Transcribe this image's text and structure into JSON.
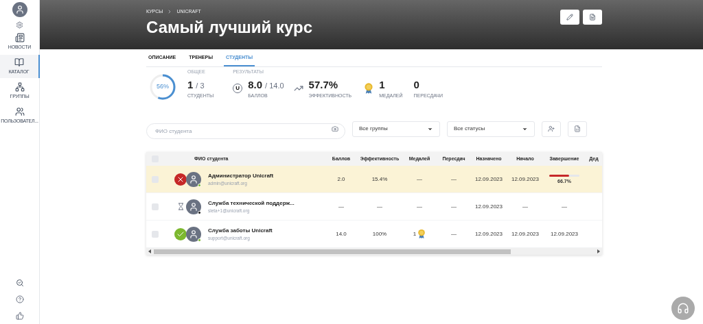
{
  "sidebar": {
    "items": [
      {
        "label": "НОВОСТИ",
        "selected": false
      },
      {
        "label": "КАТАЛОГ",
        "selected": true
      },
      {
        "label": "ГРУППЫ",
        "selected": false
      },
      {
        "label": "ПОЛЬЗОВАТЕЛ...",
        "selected": false
      }
    ]
  },
  "breadcrumbs": [
    "КУРСЫ",
    "UNICRAFT"
  ],
  "title": "Самый лучший курс",
  "tabs": [
    {
      "label": "ОПИСАНИЕ",
      "selected": false
    },
    {
      "label": "ТРЕНЕРЫ",
      "selected": false
    },
    {
      "label": "СТУДЕНТЫ",
      "selected": true
    }
  ],
  "progress": {
    "reading": "56%",
    "level": 0.56
  },
  "stats": {
    "general_label": "ОБЩЕЕ",
    "results_label": "РЕЗУЛЬТАТЫ",
    "students": {
      "value": "1",
      "total": "/ 3",
      "label": "СТУДЕНТЫ"
    },
    "points_icon": "U",
    "points": {
      "value": "8.0",
      "total": "/ 14.0",
      "label": "БАЛЛОВ"
    },
    "efficiency": {
      "value": "57.7%",
      "label": "ЭФФЕКТИВНОСТЬ"
    },
    "medals": {
      "value": "1",
      "label": "МЕДАЛЕЙ"
    },
    "retakes": {
      "value": "0",
      "label": "ПЕРЕСДАЧИ"
    }
  },
  "filters": {
    "search": {
      "placeholder": "ФИО студента"
    },
    "groups": "Все группы",
    "statuses": "Все статусы"
  },
  "table": {
    "columns": [
      "ФИО студента",
      "Баллов",
      "Эффективность",
      "Медалей",
      "Пересдач",
      "Назначено",
      "Начало",
      "Завершение",
      "Дед"
    ],
    "select_all_checked": false,
    "rows": [
      {
        "checked": false,
        "kind": "failed",
        "online": true,
        "highlighted": true,
        "name": "Администратор Unicraft",
        "email": "admin@unicraft.org",
        "points": "2.0",
        "efficiency": "15.4%",
        "medals": "—",
        "medal_icon": false,
        "retakes": "—",
        "assigned": "12.09.2023",
        "start": "12.09.2023",
        "finish": {
          "kind": "progress",
          "level": 0.667,
          "reading": "66.7%"
        }
      },
      {
        "checked": false,
        "kind": "pending",
        "online": false,
        "highlighted": false,
        "name": "Служба технической поддерж...",
        "email": "sleta+1@unicraft.org",
        "points": "—",
        "efficiency": "—",
        "medals": "—",
        "medal_icon": false,
        "retakes": "—",
        "assigned": "12.09.2023",
        "start": "—",
        "finish": {
          "kind": "text",
          "text": "—"
        }
      },
      {
        "checked": false,
        "kind": "passed",
        "online": true,
        "highlighted": false,
        "name": "Служба заботы Unicraft",
        "email": "support@unicraft.org",
        "points": "14.0",
        "efficiency": "100%",
        "medals": "1",
        "medal_icon": true,
        "retakes": "—",
        "assigned": "12.09.2023",
        "start": "12.09.2023",
        "finish": {
          "kind": "text",
          "text": "12.09.2023"
        }
      }
    ]
  }
}
